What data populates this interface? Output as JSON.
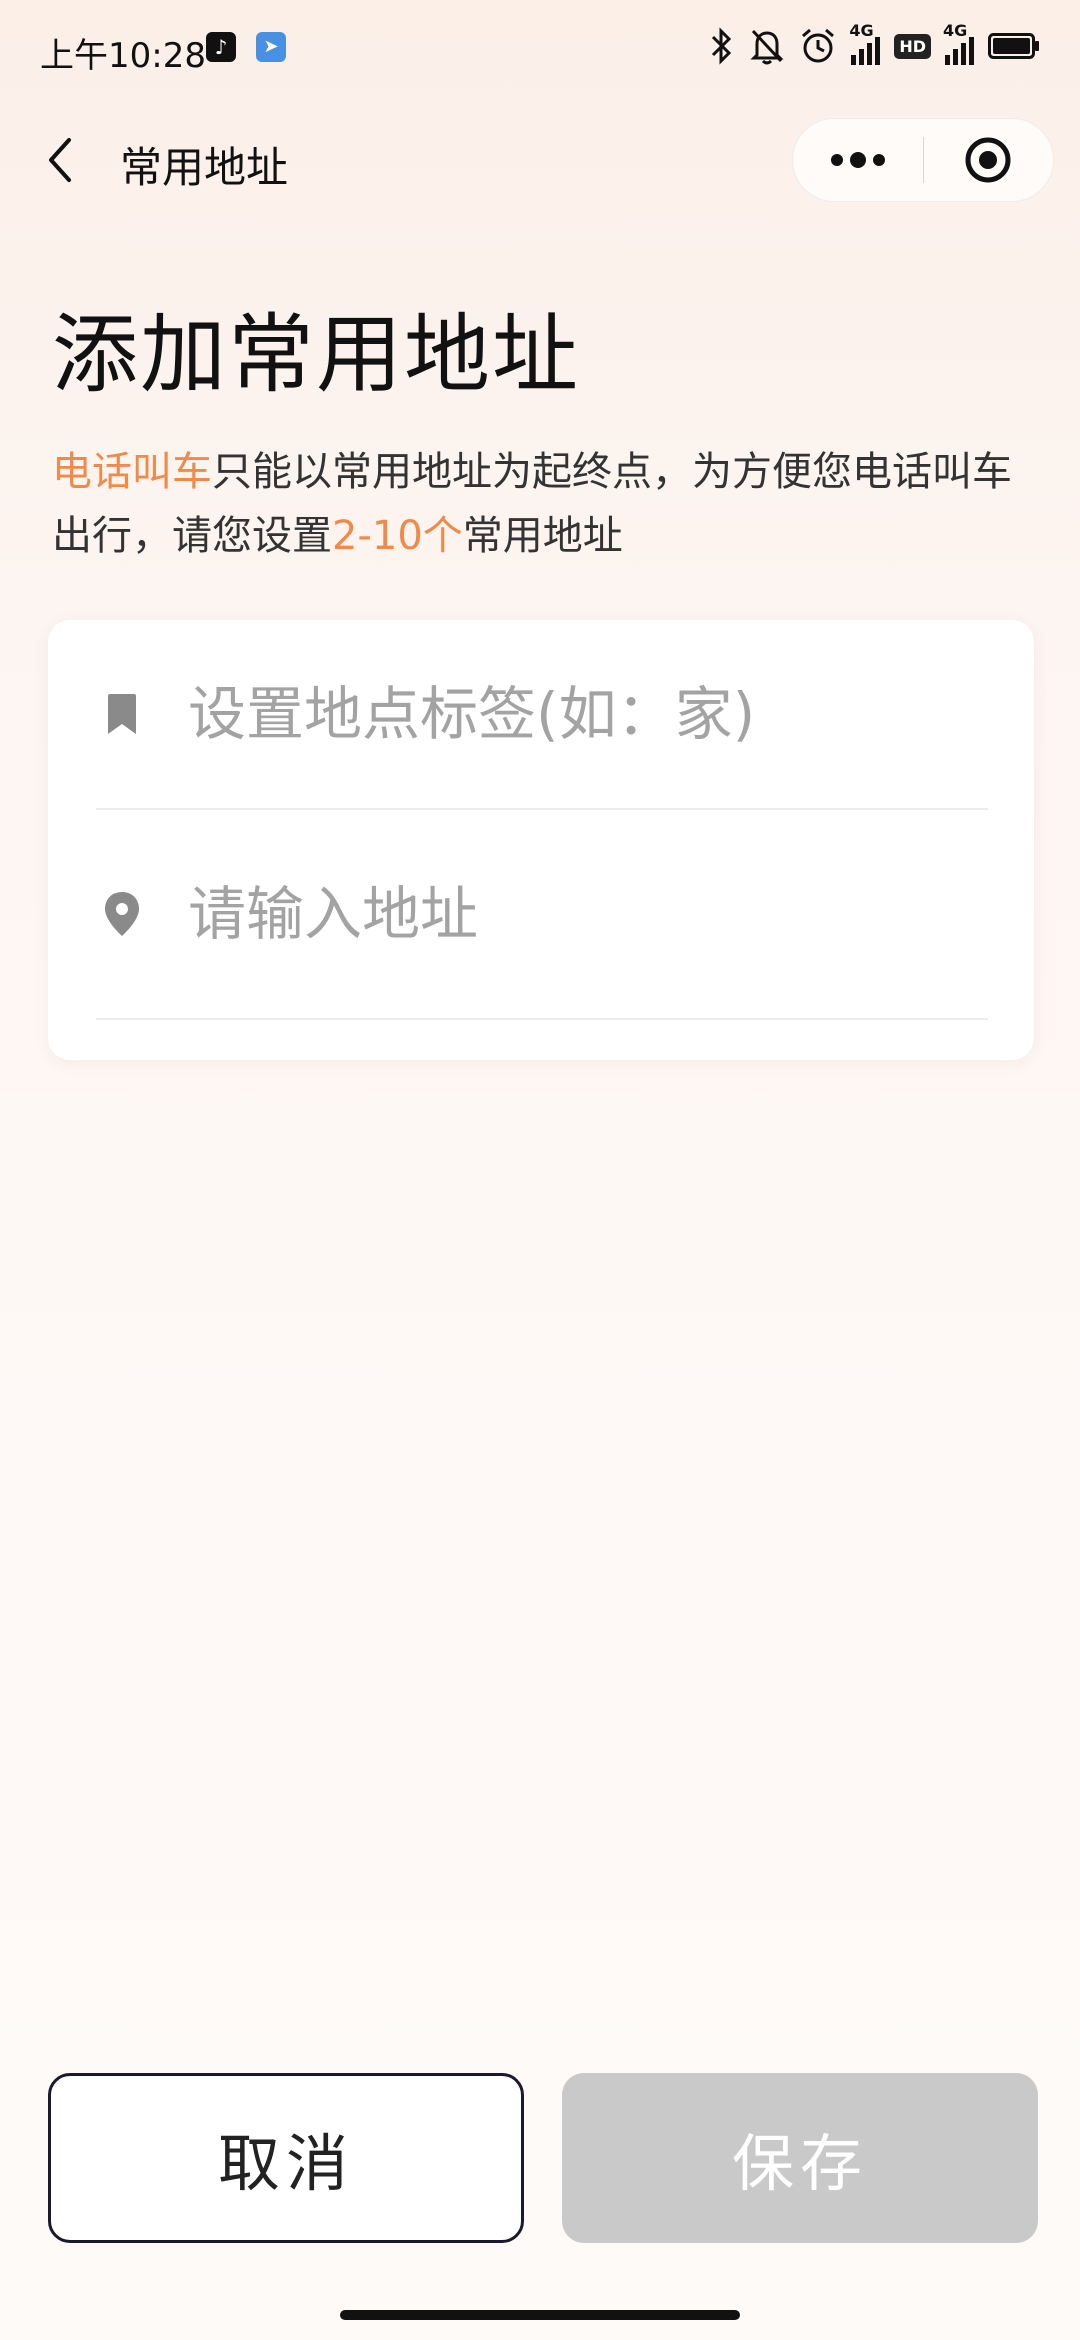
{
  "status_bar": {
    "time": "上午10:28",
    "hd": "HD",
    "network_1": "4G",
    "network_2": "4G"
  },
  "nav": {
    "title": "常用地址"
  },
  "heading": "添加常用地址",
  "description": {
    "part1": "电话叫车",
    "part2": "只能以常用地址为起终点，为方便您电话叫车出行，请您设置",
    "part3": "2-10个",
    "part4": "常用地址"
  },
  "form": {
    "label_placeholder": "设置地点标签(如：家)",
    "address_placeholder": "请输入地址"
  },
  "buttons": {
    "cancel": "取消",
    "save": "保存"
  },
  "colors": {
    "accent": "#f08a4b",
    "disabled": "#c9c9c9"
  }
}
